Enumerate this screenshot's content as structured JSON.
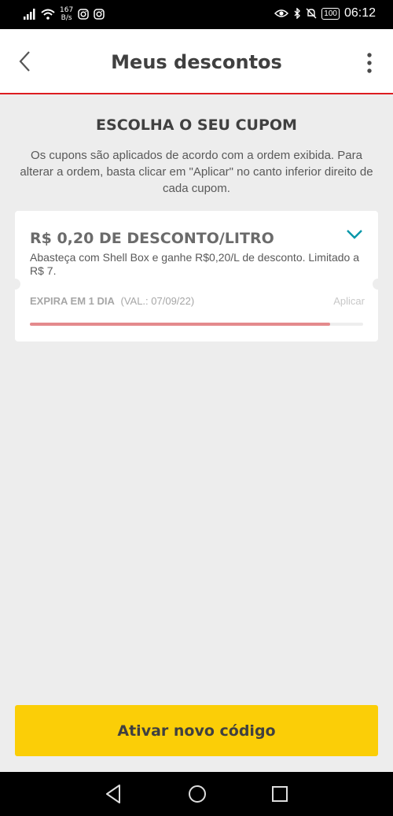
{
  "status_bar": {
    "network_speed_value": "167",
    "network_speed_unit": "B/s",
    "battery": "100",
    "time": "06:12"
  },
  "header": {
    "title": "Meus descontos"
  },
  "main": {
    "section_title": "ESCOLHA O SEU CUPOM",
    "section_subtitle": "Os cupons são aplicados de acordo com a ordem exibida. Para alterar a ordem, basta clicar em \"Aplicar\" no canto inferior direito de cada cupom."
  },
  "coupon": {
    "title": "R$ 0,20 DE DESCONTO/LITRO",
    "description": "Abasteça com Shell Box e ganhe R$0,20/L de desconto. Limitado a R$ 7.",
    "expire_label": "EXPIRA EM 1 DIA",
    "expire_validity": "(VAL.: 07/09/22)",
    "apply_label": "Aplicar",
    "progress": 0.9
  },
  "footer": {
    "activate_label": "Ativar novo código"
  },
  "colors": {
    "accent_yellow": "#fbce07",
    "header_red_line": "#dd1d21",
    "chevron_teal": "#0097a9",
    "progress_fill": "#e48a8c"
  }
}
